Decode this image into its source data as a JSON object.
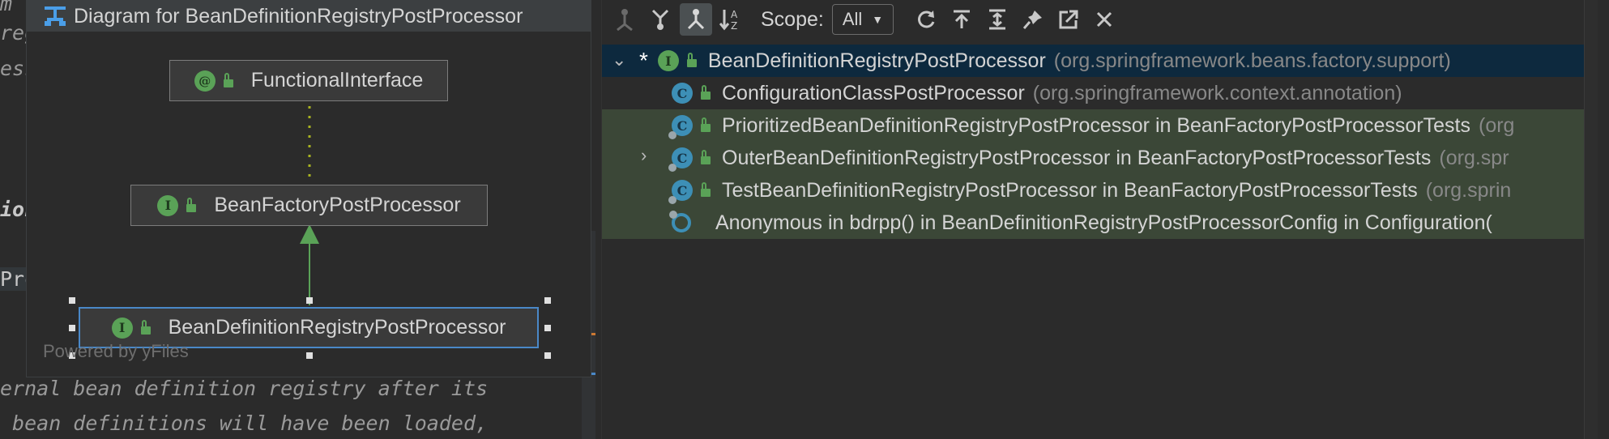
{
  "editor": {
    "fragments": [
      "m",
      "reg",
      "ess",
      "ion",
      "Pro",
      "ernal bean definition registry after its",
      " bean definitions will have been loaded,"
    ]
  },
  "diagram": {
    "title": "Diagram for BeanDefinitionRegistryPostProcessor",
    "nodes": {
      "functional_interface": {
        "badge": "@",
        "label": "FunctionalInterface"
      },
      "bean_factory_pp": {
        "badge": "I",
        "label": "BeanFactoryPostProcessor"
      },
      "bdrpp": {
        "badge": "I",
        "label": "BeanDefinitionRegistryPostProcessor"
      }
    },
    "powered_by": "Powered by yFiles"
  },
  "toolbar": {
    "scope_label": "Scope:",
    "scope_value": "All"
  },
  "tree": {
    "root": {
      "star": "*",
      "badge": "I",
      "name": "BeanDefinitionRegistryPostProcessor",
      "package": "(org.springframework.beans.factory.support)"
    },
    "rows": [
      {
        "badge": "C",
        "name": "ConfigurationClassPostProcessor",
        "package": "(org.springframework.context.annotation)"
      },
      {
        "badge": "C",
        "name": "PrioritizedBeanDefinitionRegistryPostProcessor in BeanFactoryPostProcessorTests",
        "package": "(org"
      },
      {
        "badge": "C",
        "name": "OuterBeanDefinitionRegistryPostProcessor in BeanFactoryPostProcessorTests",
        "package": "(org.spr"
      },
      {
        "badge": "C",
        "name": "TestBeanDefinitionRegistryPostProcessor in BeanFactoryPostProcessorTests",
        "package": "(org.sprin"
      },
      {
        "badge": "",
        "name": "Anonymous in bdrpp() in BeanDefinitionRegistryPostProcessorConfig in Configuration(",
        "package": ""
      }
    ]
  },
  "colors": {
    "selection_bg": "#0d293e",
    "test_row_bg": "#3b4737",
    "interface_badge": "#5aa257",
    "class_badge": "#3d8fb6",
    "selected_node_border": "#4a88c7",
    "inheritance_arrow": "#5aa257",
    "dotted_edge": "#a8b320"
  }
}
